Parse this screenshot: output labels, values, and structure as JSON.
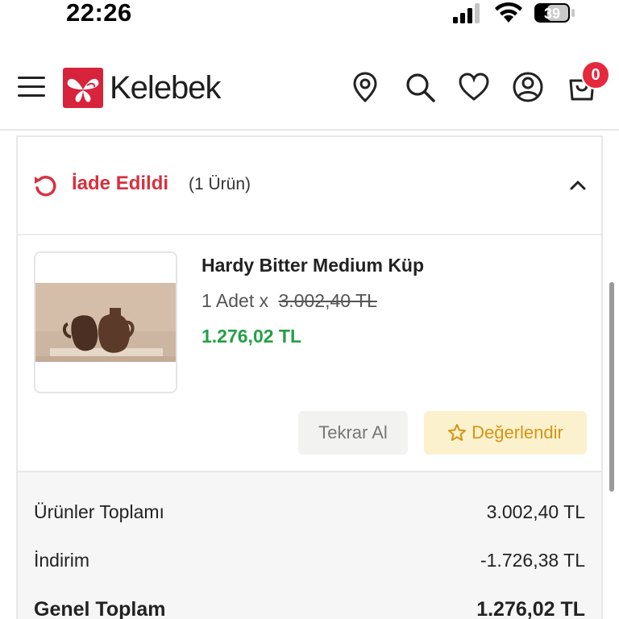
{
  "status_bar": {
    "time": "22:26",
    "battery_level": "39",
    "icons": [
      "signal-icon",
      "wifi-icon",
      "battery-icon"
    ]
  },
  "header": {
    "brand": "Kelebek",
    "cart_count": "0",
    "icons": [
      "menu-icon",
      "location-pin-icon",
      "search-icon",
      "heart-icon",
      "user-icon",
      "cart-icon"
    ],
    "brand_color": "#d7233b"
  },
  "return_section": {
    "title": "İade Edildi",
    "count_text": "(1 Ürün)",
    "icon": "return-arrow-icon",
    "title_color": "#d8303f"
  },
  "product": {
    "name": "Hardy Bitter Medium Küp",
    "qty_prefix": "1 Adet x",
    "original_price": "3.002,40 TL",
    "current_price": "1.276,02 TL",
    "price_color": "#23a045",
    "image_icon": "vase-product-image"
  },
  "actions": {
    "reorder_label": "Tekrar Al",
    "rate_label": "Değerlendir",
    "rate_icon": "star-icon"
  },
  "totals": {
    "subtotal_label": "Ürünler Toplamı",
    "subtotal_value": "3.002,40 TL",
    "discount_label": "İndirim",
    "discount_value": "-1.726,38 TL",
    "grand_label": "Genel Toplam",
    "grand_value": "1.276,02 TL"
  }
}
